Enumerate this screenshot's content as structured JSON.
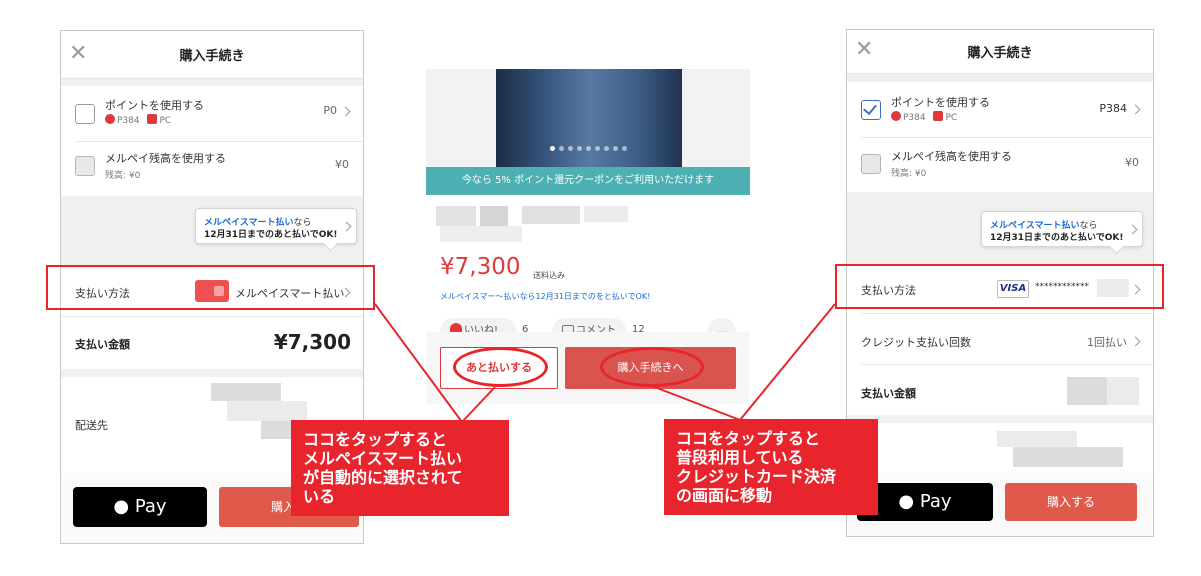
{
  "left_screen": {
    "header_title": "購入手続き",
    "close_glyph": "✕",
    "use_points": {
      "label": "ポイントを使用する",
      "d_points": "P384",
      "pc": "PC",
      "value": "P0"
    },
    "use_balance": {
      "label": "メルペイ残高を使用する",
      "remaining": "残高: ¥0",
      "value": "¥0"
    },
    "bubble": {
      "highlight": "メルペイスマート払い",
      "suffix": "なら",
      "line2": "12月31日までのあと払いでOK!"
    },
    "payment_method": {
      "label": "支払い方法",
      "value": "メルペイスマート払い"
    },
    "total": {
      "label": "支払い金額",
      "amount": "¥7,300"
    },
    "shipping_label": "配送先",
    "apple_pay": " Pay",
    "buy_label": "購入す"
  },
  "middle_screen": {
    "coupon_banner": "今なら 5% ポイント還元クーポンをご利用いただけます",
    "price": "¥7,300",
    "tax_note": "送料込み",
    "atobarai_link": "メルペイスマー〜払いなら12月31日までのをと払いでOK!",
    "like_label": "いいね!",
    "like_count": "6",
    "comment_label": "コメント",
    "comment_count": "12",
    "more": "…",
    "atobarai_button": "あと払いする",
    "proceed_button": "購入手続きへ"
  },
  "right_screen": {
    "header_title": "購入手続き",
    "close_glyph": "✕",
    "use_points": {
      "label": "ポイントを使用する",
      "d_points": "P384",
      "pc": "PC",
      "value": "P384"
    },
    "use_balance": {
      "label": "メルペイ残高を使用する",
      "remaining": "残高: ¥0",
      "value": "¥0"
    },
    "bubble": {
      "highlight": "メルペイスマート払い",
      "suffix": "なら",
      "line2": "12月31日までのあと払いでOK!"
    },
    "payment_method": {
      "label": "支払い方法",
      "card_brand": "VISA",
      "card_mask": "************"
    },
    "installments": {
      "label": "クレジット支払い回数",
      "value": "1回払い"
    },
    "total_label": "支払い金額",
    "apple_pay": " Pay",
    "buy_label": "購入する"
  },
  "annotations": {
    "left_callout": [
      "ココをタップすると",
      "メルペイスマート払い",
      "が自動的に選択されて",
      "いる"
    ],
    "right_callout": [
      "ココをタップすると",
      "普段利用している",
      "クレジットカード決済",
      "の画面に移動"
    ],
    "highlight_color": "#e8242d"
  }
}
